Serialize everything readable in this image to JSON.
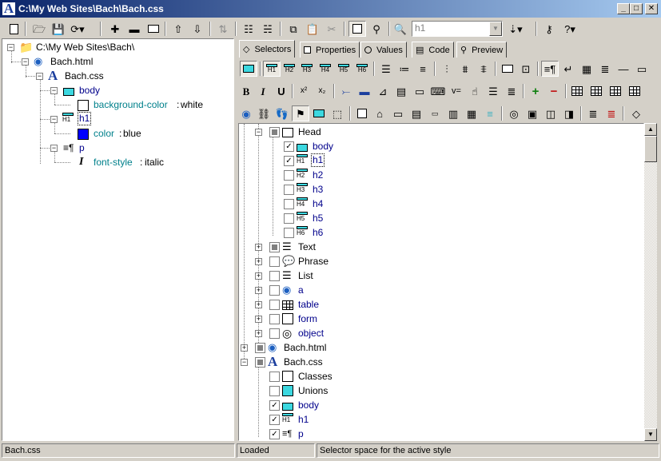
{
  "window": {
    "title": "C:\\My Web Sites\\Bach\\Bach.css",
    "app_icon_letter": "A",
    "minimize_glyph": "_",
    "maximize_glyph": "□",
    "close_glyph": "✕"
  },
  "toolbar": {
    "style_combo": {
      "value": "h1"
    }
  },
  "left_tree": {
    "root": "C:\\My Web Sites\\Bach\\",
    "html_file": "Bach.html",
    "css_file": "Bach.css",
    "body": "body",
    "body_prop_name": "background-color",
    "body_prop_sep": ":",
    "body_prop_value": "white",
    "h1": "h1",
    "h1_prop_name": "color",
    "h1_prop_sep": ":",
    "h1_prop_value": "blue",
    "p": "p",
    "p_prop_name": "font-style",
    "p_prop_sep": ":",
    "p_prop_value": "italic"
  },
  "tabs": [
    "Selectors",
    "Properties",
    "Values",
    "Code",
    "Preview"
  ],
  "right_tree": {
    "head": "Head",
    "head_items": [
      "body",
      "h1",
      "h2",
      "h3",
      "h4",
      "h5",
      "h6"
    ],
    "groups": [
      "Text",
      "Phrase",
      "List",
      "a",
      "table",
      "form",
      "object"
    ],
    "html_file": "Bach.html",
    "css_file": "Bach.css",
    "css_items": [
      "Classes",
      "Unions",
      "body",
      "h1",
      "p"
    ]
  },
  "heading_icon_labels": [
    "H1",
    "H2",
    "H3",
    "H4",
    "H5",
    "H6"
  ],
  "format_buttons": {
    "bold": "B",
    "italic": "I",
    "underline": "U"
  },
  "status": {
    "file": "Bach.css",
    "state": "Loaded",
    "hint": "Selector space for the active style"
  },
  "colors": {
    "title_start": "#0a246a",
    "title_end": "#a6caf0",
    "selector_blue": "#00008b",
    "property_teal": "#00808b",
    "swatch_blue": "#0000ff",
    "swatch_white": "#ffffff",
    "selector_cyan": "#3cd8e0"
  }
}
